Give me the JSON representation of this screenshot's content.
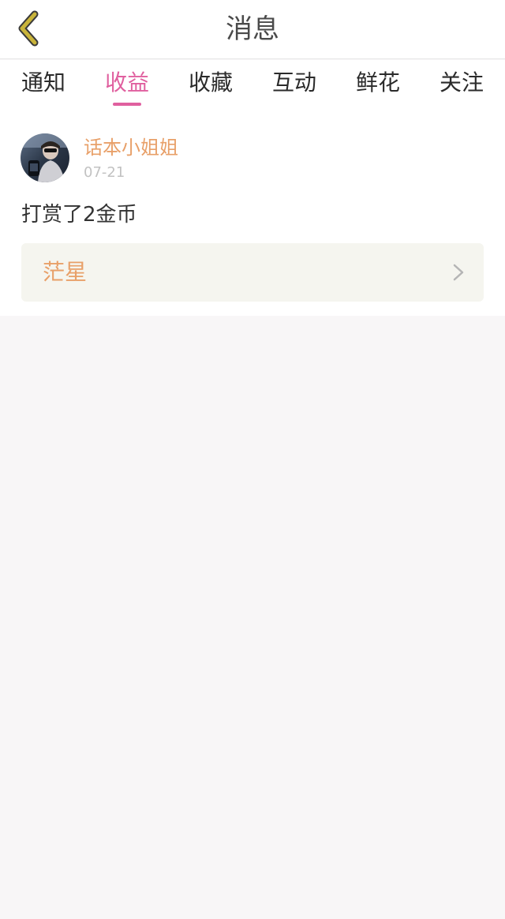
{
  "header": {
    "title": "消息",
    "back_icon": "chevron-left-icon",
    "back_icon_color": "#c9b43a"
  },
  "tabs": [
    {
      "label": "通知",
      "active": false
    },
    {
      "label": "收益",
      "active": true
    },
    {
      "label": "收藏",
      "active": false
    },
    {
      "label": "互动",
      "active": false
    },
    {
      "label": "鲜花",
      "active": false
    },
    {
      "label": "关注",
      "active": false
    }
  ],
  "colors": {
    "accent_pink": "#e0609f",
    "username_orange": "#e8a069",
    "card_background": "#f5f5ef",
    "page_background": "#f8f6f7"
  },
  "messages": [
    {
      "username": "话本小姐姐",
      "date": "07-21",
      "text": "打赏了2金币",
      "link_label": "茫星",
      "link_icon": "chevron-right-icon"
    }
  ]
}
